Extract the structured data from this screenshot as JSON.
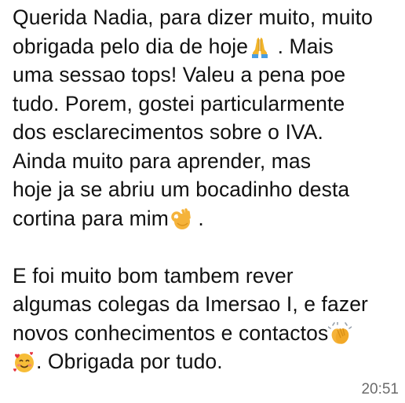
{
  "message": {
    "lines": [
      {
        "text": "Querida Nadia, para dizer muito, muito"
      },
      {
        "text": "obrigada pelo dia de hoje",
        "emoji": "folded-hands-icon",
        "after": " . Mais"
      },
      {
        "text": "uma sessao tops! Valeu a pena poe"
      },
      {
        "text": "tudo. Porem, gostei particularmente"
      },
      {
        "text": "dos esclarecimentos sobre o IVA."
      },
      {
        "text": "Ainda muito para aprender, mas"
      },
      {
        "text": "hoje ja se abriu um bocadinho desta"
      },
      {
        "text": "cortina para mim",
        "emoji": "ok-hand-icon",
        "after": " ."
      },
      {
        "text": ""
      },
      {
        "text": "E foi muito bom tambem rever"
      },
      {
        "text": "algumas colegas da Imersao I, e fazer"
      },
      {
        "text": "novos conhecimentos e contactos",
        "emoji": "clapping-hands-icon",
        "after": ""
      },
      {
        "text": "",
        "emoji": "smiling-face-with-hearts-icon",
        "after": ". Obrigada por tudo."
      }
    ],
    "time": "20:51"
  }
}
